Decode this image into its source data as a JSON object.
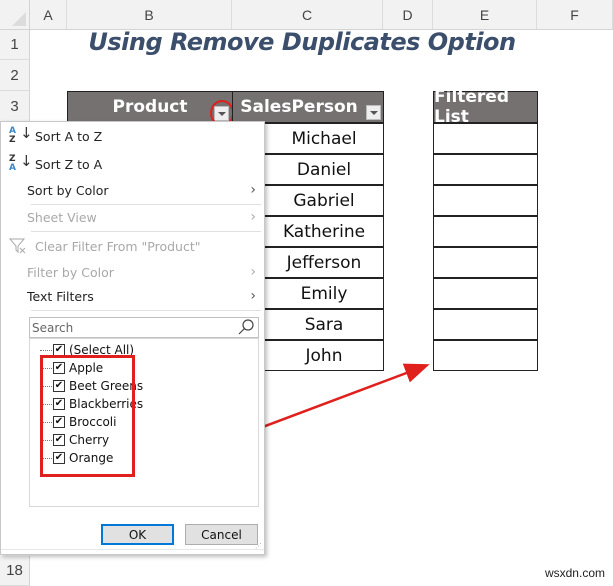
{
  "columns": [
    "A",
    "B",
    "C",
    "D",
    "E",
    "F"
  ],
  "rows_visible": [
    "1",
    "2",
    "3",
    "18"
  ],
  "title": "Using Remove Duplicates Option",
  "table": {
    "headers": [
      "Product",
      "SalesPerson"
    ],
    "salespeople": [
      "Michael",
      "Daniel",
      "Gabriel",
      "Katherine",
      "Jefferson",
      "Emily",
      "Sara",
      "John"
    ]
  },
  "filtered_list": {
    "header": "Filtered List",
    "values": [
      "",
      "",
      "",
      "",
      "",
      "",
      "",
      ""
    ]
  },
  "filter_menu": {
    "sort_az": "Sort A to Z",
    "sort_za": "Sort Z to A",
    "sort_by_color": "Sort by Color",
    "sheet_view": "Sheet View",
    "clear_filter": "Clear Filter From \"Product\"",
    "filter_by_color": "Filter by Color",
    "text_filters": "Text Filters",
    "search_placeholder": "Search",
    "items": [
      {
        "label": "(Select All)",
        "checked": true
      },
      {
        "label": "Apple",
        "checked": true
      },
      {
        "label": "Beet Greens",
        "checked": true
      },
      {
        "label": "Blackberries",
        "checked": true
      },
      {
        "label": "Broccoli",
        "checked": true
      },
      {
        "label": "Cherry",
        "checked": true
      },
      {
        "label": "Orange",
        "checked": true
      }
    ],
    "ok_label": "OK",
    "cancel_label": "Cancel"
  },
  "colors": {
    "header_fill": "#767171",
    "title_color": "#3b4e6b",
    "annotation_red": "#e0201c",
    "ok_focus": "#0078d7"
  },
  "watermark": "wsxdn.com"
}
